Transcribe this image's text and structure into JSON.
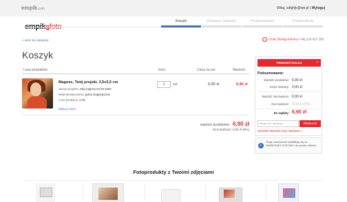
{
  "topbar": {
    "site": "empik",
    "site_suffix": ".com",
    "greeting": "Witaj, sdfghjk@wp.pl",
    "logout": "Wyloguj"
  },
  "header": {
    "logo_text": "empik",
    "logo_foto": "foto",
    "steps": [
      {
        "label": "Koszyk",
        "active": true
      },
      {
        "label": "Dostawa i płatność",
        "active": false
      },
      {
        "label": "Podsumowanie",
        "active": false
      },
      {
        "label": "Potwierdzenie",
        "active": false
      }
    ]
  },
  "nav": {
    "back_link": "« wróć do zakupów",
    "help_link": "Dział Obsługi Klienta",
    "help_phone": "(+48) 224 627 256"
  },
  "page": {
    "title": "Koszyk"
  },
  "table": {
    "headers": [
      "Lista produktów",
      "Ilość",
      "Cena za szt.",
      "Wartość"
    ]
  },
  "cart_item": {
    "name": "Magnes, Twój projekt, 3,5x3,5 cm",
    "project_label": "Nazwa projektu:",
    "project_value": "Mój magnes 04-03-2020",
    "material_label": "Materiał wykonania:",
    "material_value": "guma magnetyczna",
    "time_label": "Czas produkcji:",
    "time_value": "4 dni",
    "edit": "Edytuj",
    "delete": "Usuń",
    "quantity": "1",
    "unit": "szt.",
    "unit_price": "6,90 zł",
    "value": "6,90 zł"
  },
  "totals": {
    "products_label": "wartość produktów:",
    "products_value": "6,90 zł",
    "savings_label": "Oszczędzasz:",
    "savings_value": "0,00 zł (0%)"
  },
  "summary": {
    "cta": "PRZEJDŹ DALEJ",
    "title": "Podsumowanie:",
    "products_label": "Wartość produktów:",
    "products_value": "6,90 zł",
    "delivery_label": "Koszt dostawy:",
    "delivery_value": "0,00 zł",
    "order_label": "Wartość zamówienia:",
    "order_value": "6,90 zł",
    "savings_label": "Oszczędzasz:",
    "savings_value": "0,00 zł (0%)",
    "pay_label": "Do zapłaty:",
    "pay_value": "6,90 zł",
    "code_placeholder": "Wpisz kod rabatowy",
    "code_button": "PRZELICZ",
    "check_codes": "Sprawdź aktualne kody rabatowe »",
    "free_shipping": "Twoje zamówienie kwalifikuje się do DARMOWEJ DOSTAWY do punktu odbioru."
  },
  "section": {
    "title": "Fotoprodukty z Twoimi zdjęciami"
  },
  "colors": {
    "accent": "#e8262c",
    "step_active": "#3a6fc4",
    "link": "#3a6fc4"
  }
}
